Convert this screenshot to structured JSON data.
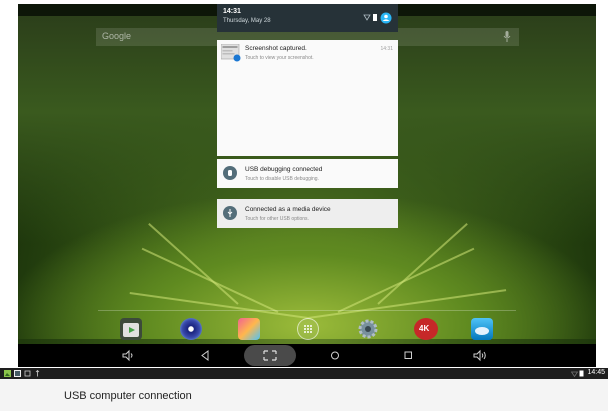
{
  "home": {
    "search_placeholder": "Google",
    "dock_apps": [
      "play-store",
      "music",
      "gallery",
      "all-apps",
      "settings",
      "4k-player",
      "cloud"
    ],
    "dock_badge": "4K"
  },
  "shade": {
    "time": "14:31",
    "date": "Thursday, May 28",
    "notifications": [
      {
        "title": "Screenshot captured.",
        "subtitle": "Touch to view your screenshot.",
        "time": "14:31",
        "icon": "screenshot-thumbnail"
      },
      {
        "title": "USB debugging connected",
        "subtitle": "Touch to disable USB debugging.",
        "icon": "android-debug-icon"
      },
      {
        "title": "Connected as a media device",
        "subtitle": "Touch for other USB options.",
        "icon": "usb-icon"
      }
    ]
  },
  "navbar": {
    "icons": [
      "volume-down-icon",
      "back-icon",
      "screenshot-icon",
      "home-icon",
      "recents-icon",
      "volume-up-icon"
    ]
  },
  "usb_screen": {
    "title": "USB computer connection",
    "status_time": "14:45"
  }
}
